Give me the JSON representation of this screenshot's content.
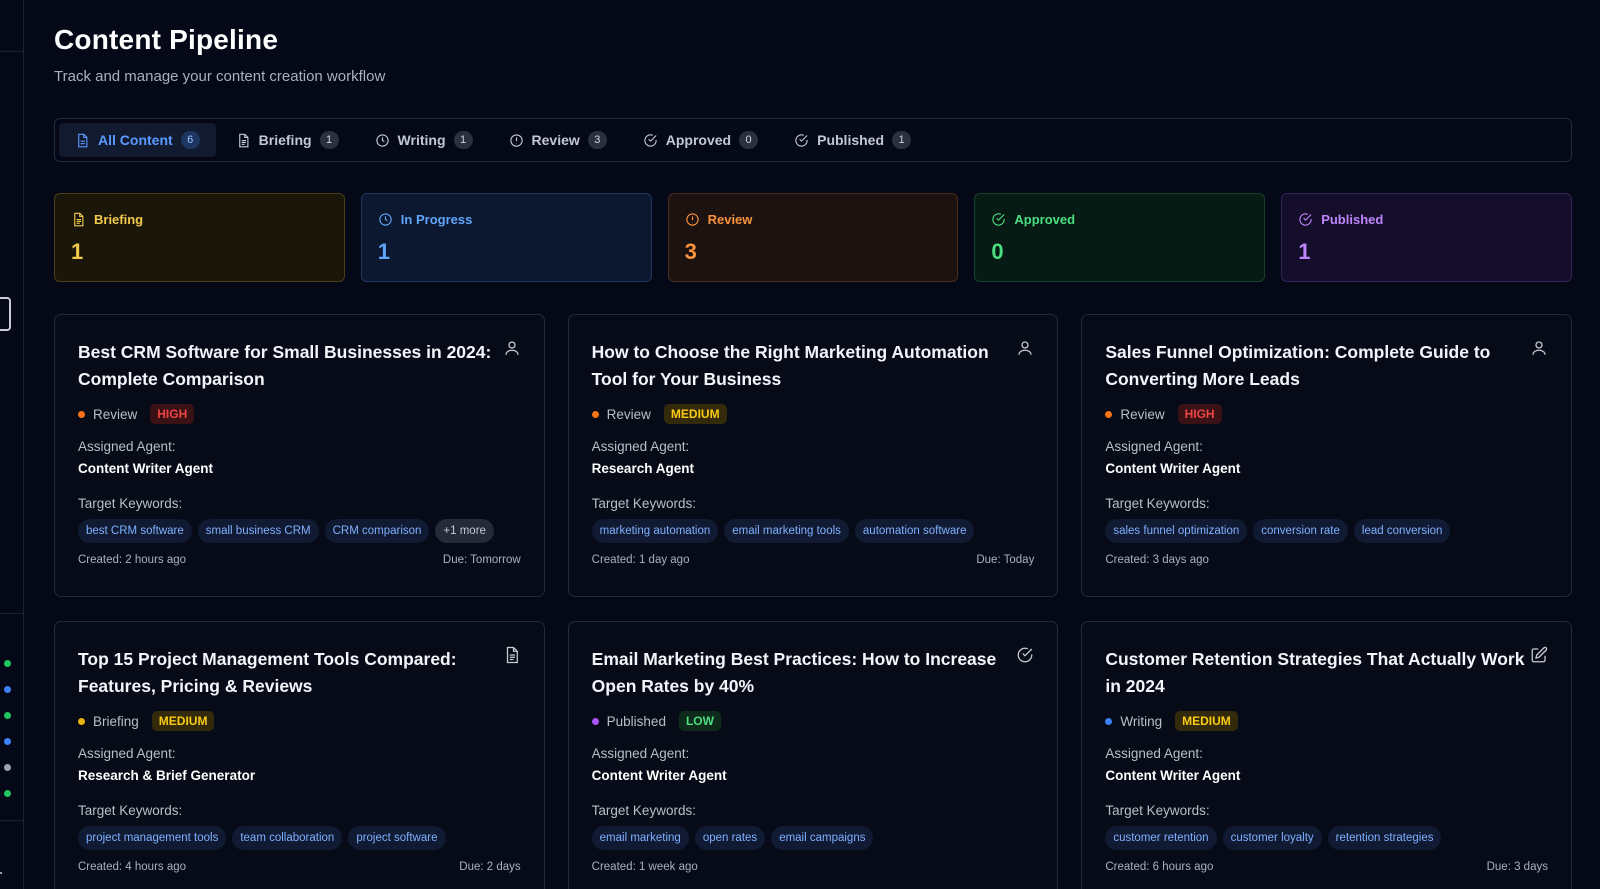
{
  "header": {
    "title": "Content Pipeline",
    "subtitle": "Track and manage your content creation workflow"
  },
  "tabs": [
    {
      "label": "All Content",
      "count": "6",
      "icon": "document-icon",
      "active": true
    },
    {
      "label": "Briefing",
      "count": "1",
      "icon": "file-text-icon",
      "active": false
    },
    {
      "label": "Writing",
      "count": "1",
      "icon": "clock-icon",
      "active": false
    },
    {
      "label": "Review",
      "count": "3",
      "icon": "alert-circle-icon",
      "active": false
    },
    {
      "label": "Approved",
      "count": "0",
      "icon": "check-circle-icon",
      "active": false
    },
    {
      "label": "Published",
      "count": "1",
      "icon": "check-circle-icon",
      "active": false
    }
  ],
  "stats": [
    {
      "label": "Briefing",
      "value": "1",
      "icon": "file-text-icon",
      "color": "#f2c94c",
      "bg": "#1a1609",
      "border": "#4a3f16"
    },
    {
      "label": "In Progress",
      "value": "1",
      "icon": "clock-icon",
      "color": "#60a5fa",
      "bg": "#0c1730",
      "border": "#1f3760"
    },
    {
      "label": "Review",
      "value": "3",
      "icon": "alert-circle-icon",
      "color": "#fb923c",
      "bg": "#1c1210",
      "border": "#4b2b1c"
    },
    {
      "label": "Approved",
      "value": "0",
      "icon": "check-circle-icon",
      "color": "#4ade80",
      "bg": "#081a14",
      "border": "#17402a"
    },
    {
      "label": "Published",
      "value": "1",
      "icon": "check-circle-icon",
      "color": "#c084fc",
      "bg": "#140e2a",
      "border": "#33245a"
    }
  ],
  "cards": [
    {
      "title": "Best CRM Software for Small Businesses in 2024: Complete Comparison",
      "icon": "user-icon",
      "status": "Review",
      "status_color": "#f97316",
      "priority": "HIGH",
      "priority_color": "#ef4444",
      "priority_bg": "#3a1216",
      "agent_label": "Assigned Agent:",
      "agent": "Content Writer Agent",
      "keywords_label": "Target Keywords:",
      "keywords": [
        "best CRM software",
        "small business CRM",
        "CRM comparison"
      ],
      "more": "+1 more",
      "created": "Created: 2 hours ago",
      "due": "Due: Tomorrow"
    },
    {
      "title": "How to Choose the Right Marketing Automation Tool for Your Business",
      "icon": "user-icon",
      "status": "Review",
      "status_color": "#f97316",
      "priority": "MEDIUM",
      "priority_color": "#facc15",
      "priority_bg": "#33290b",
      "agent_label": "Assigned Agent:",
      "agent": "Research Agent",
      "keywords_label": "Target Keywords:",
      "keywords": [
        "marketing automation",
        "email marketing tools",
        "automation software"
      ],
      "more": "",
      "created": "Created: 1 day ago",
      "due": "Due: Today"
    },
    {
      "title": "Sales Funnel Optimization: Complete Guide to Converting More Leads",
      "icon": "user-icon",
      "status": "Review",
      "status_color": "#f97316",
      "priority": "HIGH",
      "priority_color": "#ef4444",
      "priority_bg": "#3a1216",
      "agent_label": "Assigned Agent:",
      "agent": "Content Writer Agent",
      "keywords_label": "Target Keywords:",
      "keywords": [
        "sales funnel optimization",
        "conversion rate",
        "lead conversion"
      ],
      "more": "",
      "created": "Created: 3 days ago",
      "due": ""
    },
    {
      "title": "Top 15 Project Management Tools Compared: Features, Pricing & Reviews",
      "icon": "file-text-icon",
      "status": "Briefing",
      "status_color": "#eab308",
      "priority": "MEDIUM",
      "priority_color": "#facc15",
      "priority_bg": "#33290b",
      "agent_label": "Assigned Agent:",
      "agent": "Research & Brief Generator",
      "keywords_label": "Target Keywords:",
      "keywords": [
        "project management tools",
        "team collaboration",
        "project software"
      ],
      "more": "",
      "created": "Created: 4 hours ago",
      "due": "Due: 2 days"
    },
    {
      "title": "Email Marketing Best Practices: How to Increase Open Rates by 40%",
      "icon": "check-circle-icon",
      "status": "Published",
      "status_color": "#a855f7",
      "priority": "LOW",
      "priority_color": "#4ade80",
      "priority_bg": "#0e2a1a",
      "agent_label": "Assigned Agent:",
      "agent": "Content Writer Agent",
      "keywords_label": "Target Keywords:",
      "keywords": [
        "email marketing",
        "open rates",
        "email campaigns"
      ],
      "more": "",
      "created": "Created: 1 week ago",
      "due": ""
    },
    {
      "title": "Customer Retention Strategies That Actually Work in 2024",
      "icon": "edit-icon",
      "status": "Writing",
      "status_color": "#3b82f6",
      "priority": "MEDIUM",
      "priority_color": "#facc15",
      "priority_bg": "#33290b",
      "agent_label": "Assigned Agent:",
      "agent": "Content Writer Agent",
      "keywords_label": "Target Keywords:",
      "keywords": [
        "customer retention",
        "customer loyalty",
        "retention strategies"
      ],
      "more": "",
      "created": "Created: 6 hours ago",
      "due": "Due: 3 days"
    }
  ],
  "sidebar": {
    "status_dots": [
      "#22c55e",
      "#3b82f6",
      "#22c55e",
      "#3b82f6",
      "#9ca3af",
      "#22c55e"
    ]
  }
}
